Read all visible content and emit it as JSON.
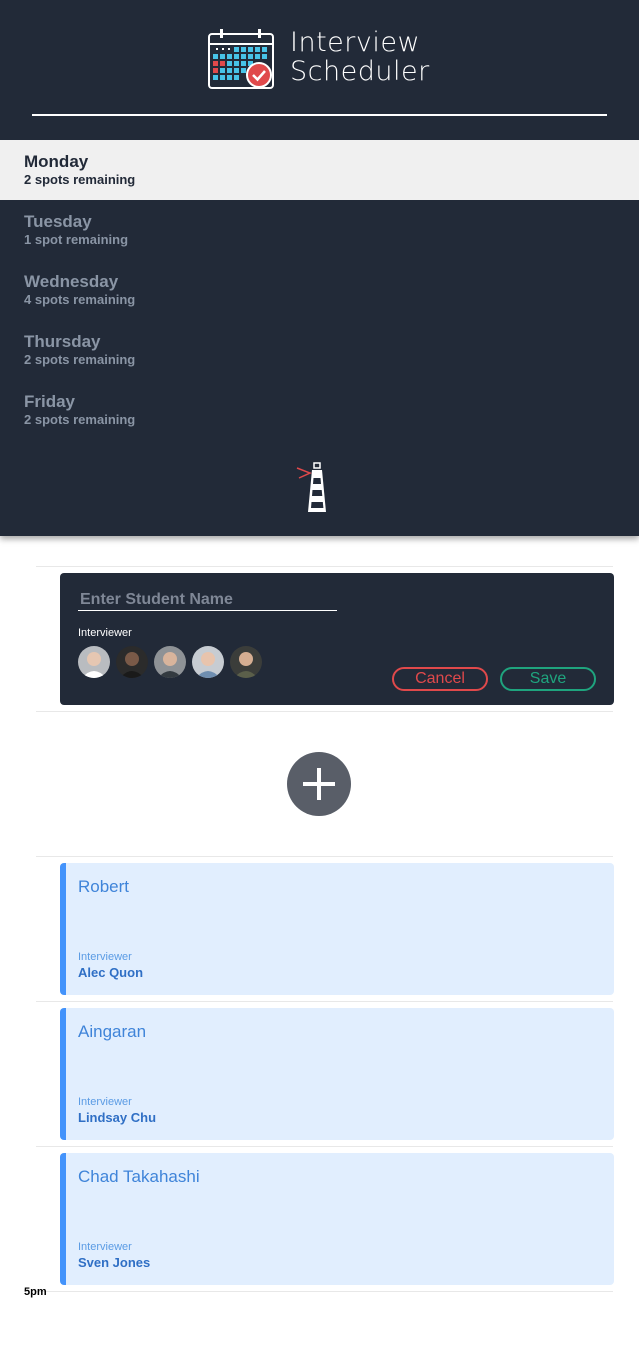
{
  "header": {
    "title_line1": "Interview",
    "title_line2": "Scheduler"
  },
  "days": [
    {
      "name": "Monday",
      "spots": "2 spots remaining",
      "selected": true
    },
    {
      "name": "Tuesday",
      "spots": "1 spot remaining",
      "selected": false
    },
    {
      "name": "Wednesday",
      "spots": "4 spots remaining",
      "selected": false
    },
    {
      "name": "Thursday",
      "spots": "2 spots remaining",
      "selected": false
    },
    {
      "name": "Friday",
      "spots": "2 spots remaining",
      "selected": false
    }
  ],
  "form": {
    "student_placeholder": "Enter Student Name",
    "student_value": "",
    "interviewer_label": "Interviewer",
    "cancel_label": "Cancel",
    "save_label": "Save"
  },
  "appointments": [
    {
      "student": "Robert",
      "label": "Interviewer",
      "interviewer": "Alec Quon"
    },
    {
      "student": "Aingaran",
      "label": "Interviewer",
      "interviewer": "Lindsay Chu"
    },
    {
      "student": "Chad Takahashi",
      "label": "Interviewer",
      "interviewer": "Sven Jones"
    }
  ],
  "time_label": "5pm",
  "icons": {
    "logo": "calendar-check-icon",
    "footer": "lighthouse-icon",
    "add": "plus-icon"
  },
  "colors": {
    "sidebar_bg": "#222a38",
    "selected_day_bg": "#f0f0f0",
    "cancel": "#e0494b",
    "save": "#1fa47e",
    "appointment_bg": "#e1eefe",
    "appointment_accent": "#4393fb"
  }
}
